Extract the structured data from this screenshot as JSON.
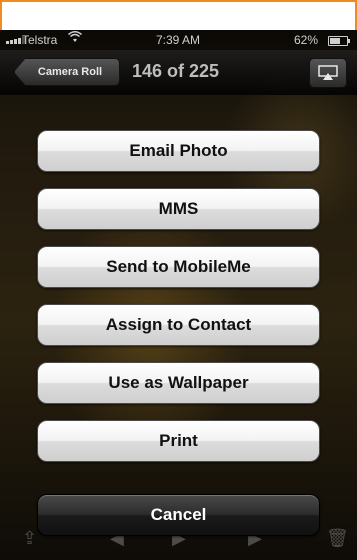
{
  "status_bar": {
    "carrier": "Telstra",
    "time": "7:39 AM",
    "battery_percent": "62%",
    "wifi_icon": "wifi-icon",
    "signal_icon": "signal-bars-icon",
    "battery_icon": "battery-icon"
  },
  "nav_bar": {
    "back_label": "Camera Roll",
    "title": "146 of 225",
    "airplay_icon": "airplay-icon"
  },
  "action_sheet": {
    "email_label": "Email Photo",
    "mms_label": "MMS",
    "mobileme_label": "Send to MobileMe",
    "assign_label": "Assign to Contact",
    "wallpaper_label": "Use as Wallpaper",
    "print_label": "Print",
    "cancel_label": "Cancel"
  },
  "toolbar": {
    "icons": [
      "share-icon",
      "previous-icon",
      "play-icon",
      "next-icon",
      "trash-icon"
    ]
  },
  "colors": {
    "frame_border": "#f08c1e",
    "sheet_button": "#f3f3f3",
    "cancel_button": "#1a1a1a"
  }
}
